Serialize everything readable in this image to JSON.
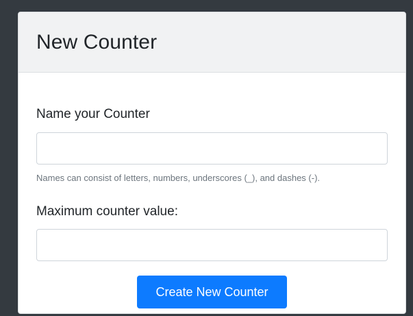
{
  "card": {
    "title": "New Counter"
  },
  "form": {
    "name_label": "Name your Counter",
    "name_value": "",
    "name_placeholder": "",
    "name_help": "Names can consist of letters, numbers, underscores (_), and dashes (-).",
    "max_label": "Maximum counter value:",
    "max_value": "",
    "max_placeholder": "",
    "submit_label": "Create New Counter"
  },
  "colors": {
    "background": "#343a40",
    "header_bg": "#f1f2f3",
    "primary_button": "#0d7bff"
  }
}
